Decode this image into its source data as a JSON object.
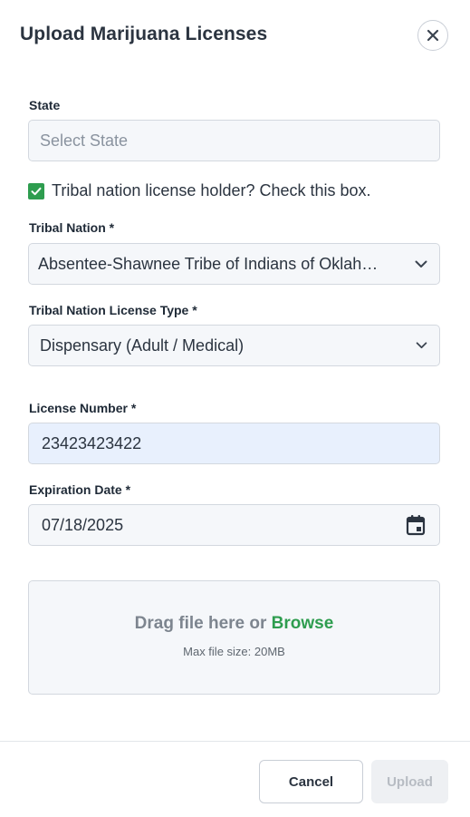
{
  "modal": {
    "title": "Upload Marijuana Licenses",
    "close_icon": "close-icon"
  },
  "state": {
    "label": "State",
    "placeholder": "Select State"
  },
  "tribal_checkbox": {
    "checked": true,
    "label": "Tribal nation license holder? Check this box.",
    "color": "#2e9d4f"
  },
  "tribal_nation": {
    "label": "Tribal Nation *",
    "value": "Absentee-Shawnee Tribe of Indians of Oklah…",
    "icon": "chevron-down-icon"
  },
  "license_type": {
    "label": "Tribal Nation License Type *",
    "value": "Dispensary (Adult / Medical)",
    "icon": "chevron-down-icon"
  },
  "license_number": {
    "label": "License Number *",
    "value": "23423423422"
  },
  "expiration": {
    "label": "Expiration Date *",
    "value": "07/18/2025",
    "icon": "calendar-icon"
  },
  "dropzone": {
    "text": "Drag file here or",
    "browse": "Browse",
    "max_size": "Max file size: 20MB"
  },
  "footer": {
    "cancel": "Cancel",
    "upload": "Upload"
  }
}
